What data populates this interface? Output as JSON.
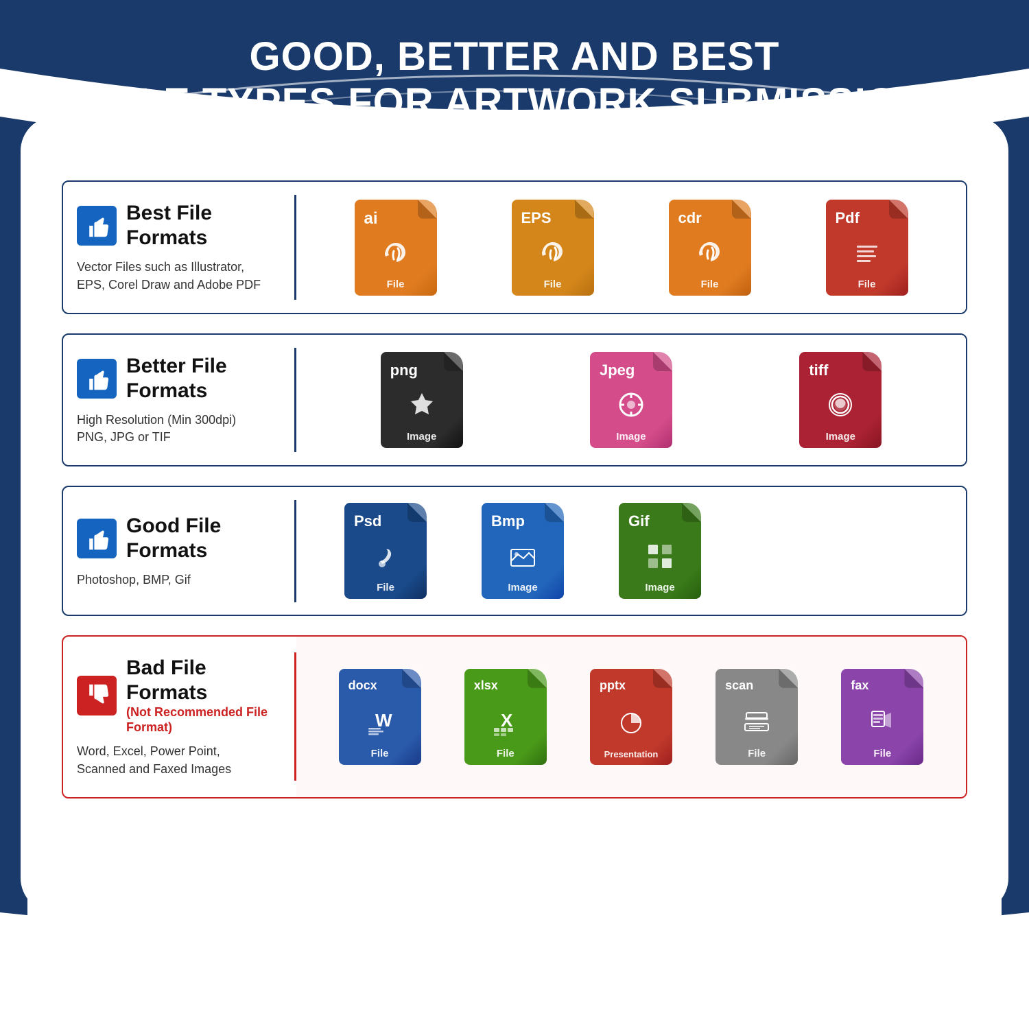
{
  "header": {
    "line1": "GOOD, BETTER AND BEST",
    "line2": "FILE TYPES FOR ARTWORK SUBMISSION"
  },
  "sections": [
    {
      "id": "best",
      "thumbs": "up",
      "title": "Best File Formats",
      "subtitle": null,
      "description": "Vector Files such as Illustrator,\nEPS, Corel Draw and Adobe PDF",
      "bad": false,
      "files": [
        {
          "ext": "ai",
          "color": "orange",
          "icon": "pen",
          "label": "File"
        },
        {
          "ext": "EPS",
          "color": "orange",
          "icon": "pen",
          "label": "File"
        },
        {
          "ext": "cdr",
          "color": "orange",
          "icon": "pen",
          "label": "File"
        },
        {
          "ext": "Pdf",
          "color": "red-dark",
          "icon": "doc",
          "label": "File"
        }
      ]
    },
    {
      "id": "better",
      "thumbs": "up",
      "title": "Better File Formats",
      "subtitle": null,
      "description": "High Resolution (Min 300dpi)\nPNG, JPG or TIF",
      "bad": false,
      "files": [
        {
          "ext": "png",
          "color": "dark-gray",
          "icon": "star",
          "label": "Image"
        },
        {
          "ext": "Jpeg",
          "color": "pink",
          "icon": "camera",
          "label": "Image"
        },
        {
          "ext": "tiff",
          "color": "red-tiff",
          "icon": "gear",
          "label": "Image"
        }
      ]
    },
    {
      "id": "good",
      "thumbs": "up",
      "title": "Good File Formats",
      "subtitle": null,
      "description": "Photoshop, BMP, Gif",
      "bad": false,
      "files": [
        {
          "ext": "Psd",
          "color": "blue-dark",
          "icon": "brush",
          "label": "File"
        },
        {
          "ext": "Bmp",
          "color": "blue-mid",
          "icon": "image",
          "label": "Image"
        },
        {
          "ext": "Gif",
          "color": "green-dark",
          "icon": "grid",
          "label": "Image"
        }
      ]
    },
    {
      "id": "bad",
      "thumbs": "down",
      "title": "Bad File Formats",
      "subtitle": "(Not Recommended File Format)",
      "description": "Word, Excel, Power Point,\nScanned and Faxed Images",
      "bad": true,
      "files": [
        {
          "ext": "docx",
          "color": "blue-word",
          "icon": "word",
          "label": "File"
        },
        {
          "ext": "xlsx",
          "color": "green-excel",
          "icon": "excel",
          "label": "File"
        },
        {
          "ext": "pptx",
          "color": "red-pptx",
          "icon": "pptx",
          "label": "Presentation"
        },
        {
          "ext": "scan",
          "color": "gray-scan",
          "icon": "scan",
          "label": "File"
        },
        {
          "ext": "fax",
          "color": "purple-fax",
          "icon": "fax",
          "label": "File"
        }
      ]
    }
  ]
}
